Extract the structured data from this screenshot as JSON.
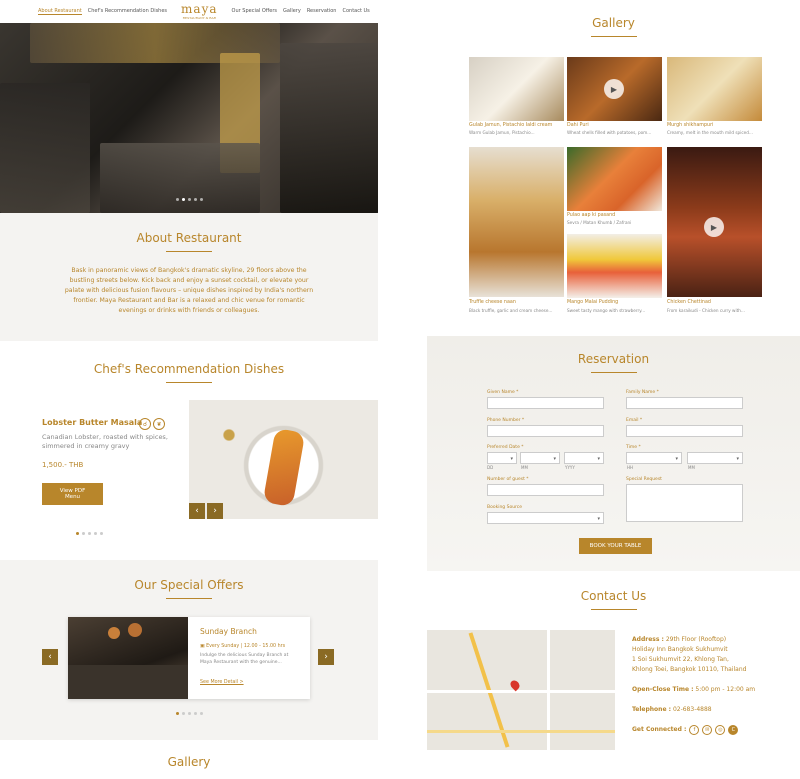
{
  "nav": {
    "items": [
      "About Restaurant",
      "Chef's Recommendation Dishes",
      "Our Special Offers",
      "Gallery",
      "Reservation",
      "Contact Us"
    ],
    "logo": "maya",
    "logo_sub": "RESTAURANT & BAR"
  },
  "about": {
    "title": "About Restaurant",
    "text": "Bask in panoramic views of Bangkok's dramatic skyline, 29 floors above the bustling streets below. Kick back and enjoy a sunset cocktail, or elevate your palate with delicious fusion flavours – unique dishes inspired by India's northern frontier. Maya Restaurant and Bar is a relaxed and chic venue for romantic evenings or drinks with friends or colleagues."
  },
  "chef": {
    "title": "Chef's Recommendation Dishes",
    "dish_name": "Lobster Butter Masala",
    "dish_desc": "Canadian Lobster, roasted with spices, simmered in creamy gravy",
    "dish_price": "1,500.- THB",
    "pdf_button": "View PDF Menu"
  },
  "offers": {
    "title": "Our Special Offers",
    "name": "Sunday Branch",
    "when": "Every Sunday | 12.00 - 15.00 hrs",
    "desc": "Indulge the delicious Sunday Branch at Maya Restaurant with the genuine...",
    "more": "See More Detail >"
  },
  "gallery_bottom_title": "Gallery",
  "gallery": {
    "title": "Gallery",
    "items": [
      {
        "caption": "Gulab Jamun, Pistachio Ialdi cream",
        "sub": "Warm Gulab Jamun, Pistachio..."
      },
      {
        "caption": "Dahi Puri",
        "sub": "Wheat shells filled with potatoes, pom..."
      },
      {
        "caption": "Murgh shikhampuri",
        "sub": "Creamy, melt in the mouth mild spiced..."
      },
      {
        "caption": "Truffle cheese naan",
        "sub": "Black truffle, garlic and cream cheese..."
      },
      {
        "caption": "Pulao aap ki pasand",
        "sub": "Sevra / Matan Khumb / Zafrani"
      },
      {
        "caption": "Mango Malai Pudding",
        "sub": "Sweet tasty mango with strawberry..."
      },
      {
        "caption": "Chicken Chettinad",
        "sub": "From karaikudi - Chicken curry with..."
      }
    ]
  },
  "reservation": {
    "title": "Reservation",
    "given_name": "Given Name *",
    "family_name": "Family Name *",
    "phone": "Phone Number *",
    "email": "Email *",
    "pref_date": "Preferred Date *",
    "time": "Time *",
    "guests": "Number of guest *",
    "special": "Special Request",
    "booking": "Booking Source",
    "dd": "DD",
    "mm": "MM",
    "yyyy": "YYYY",
    "hh": "HH",
    "min": "MM",
    "book_button": "BOOK YOUR TABLE"
  },
  "contact": {
    "title": "Contact Us",
    "address_label": "Address :",
    "address_value": "29th Floor (Rooftop)",
    "address_lines": [
      "Holiday Inn Bangkok Sukhumvit",
      "1 Soi Sukhumvit 22, Khlong Tan,",
      "Khlong Toei, Bangkok 10110, Thailand"
    ],
    "hours_label": "Open-Close Time :",
    "hours_value": "5:00 pm - 12:00 am",
    "phone_label": "Telephone :",
    "phone_value": "02-683-4888",
    "connected_label": "Get Connected :"
  }
}
